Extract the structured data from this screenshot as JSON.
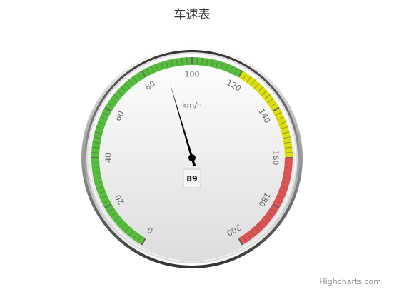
{
  "chart_data": {
    "type": "gauge",
    "title": "车速表",
    "unit": "km/h",
    "min": 0,
    "max": 200,
    "value": 89,
    "tick_labels": [
      "0",
      "20",
      "40",
      "60",
      "80",
      "100",
      "120",
      "140",
      "160",
      "180",
      "200"
    ],
    "bands": [
      {
        "from": 0,
        "to": 120,
        "color": "#55BF3B"
      },
      {
        "from": 120,
        "to": 160,
        "color": "#DDDF0D"
      },
      {
        "from": 160,
        "to": 200,
        "color": "#DF5353"
      }
    ]
  },
  "credits": "Highcharts.com"
}
